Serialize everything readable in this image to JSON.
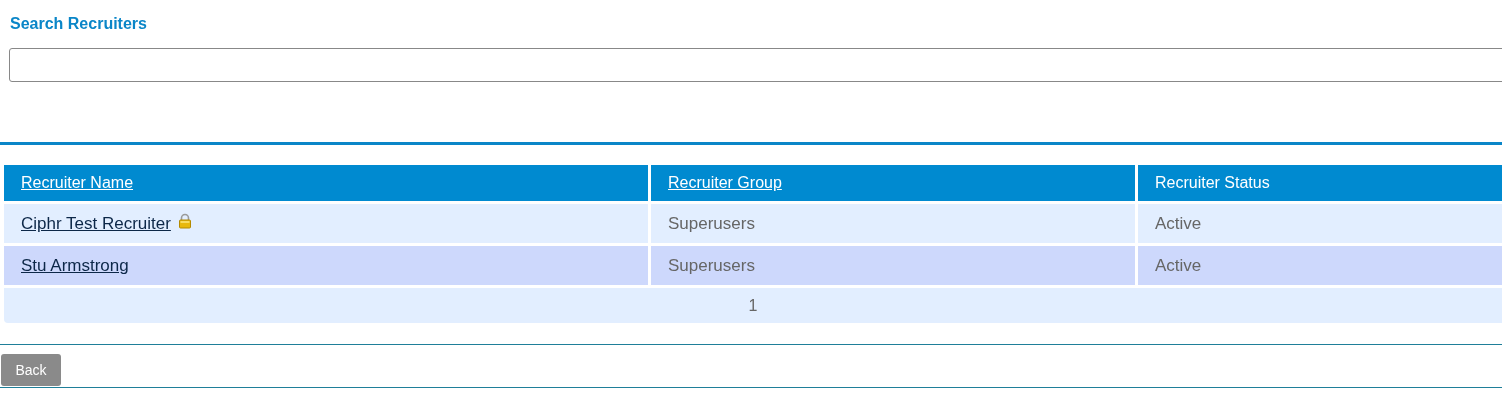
{
  "title": "Search Recruiters",
  "table": {
    "columns": [
      {
        "label": "Recruiter Name",
        "sortable": true
      },
      {
        "label": "Recruiter Group",
        "sortable": true
      },
      {
        "label": "Recruiter Status",
        "sortable": false
      }
    ],
    "rows": [
      {
        "name": "Ciphr Test Recruiter",
        "locked": true,
        "group": "Superusers",
        "status": "Active"
      },
      {
        "name": "Stu Armstrong",
        "locked": false,
        "group": "Superusers",
        "status": "Active"
      }
    ],
    "pages": [
      {
        "label": "1",
        "selected": true
      }
    ]
  },
  "buttons": [
    "Back"
  ]
}
